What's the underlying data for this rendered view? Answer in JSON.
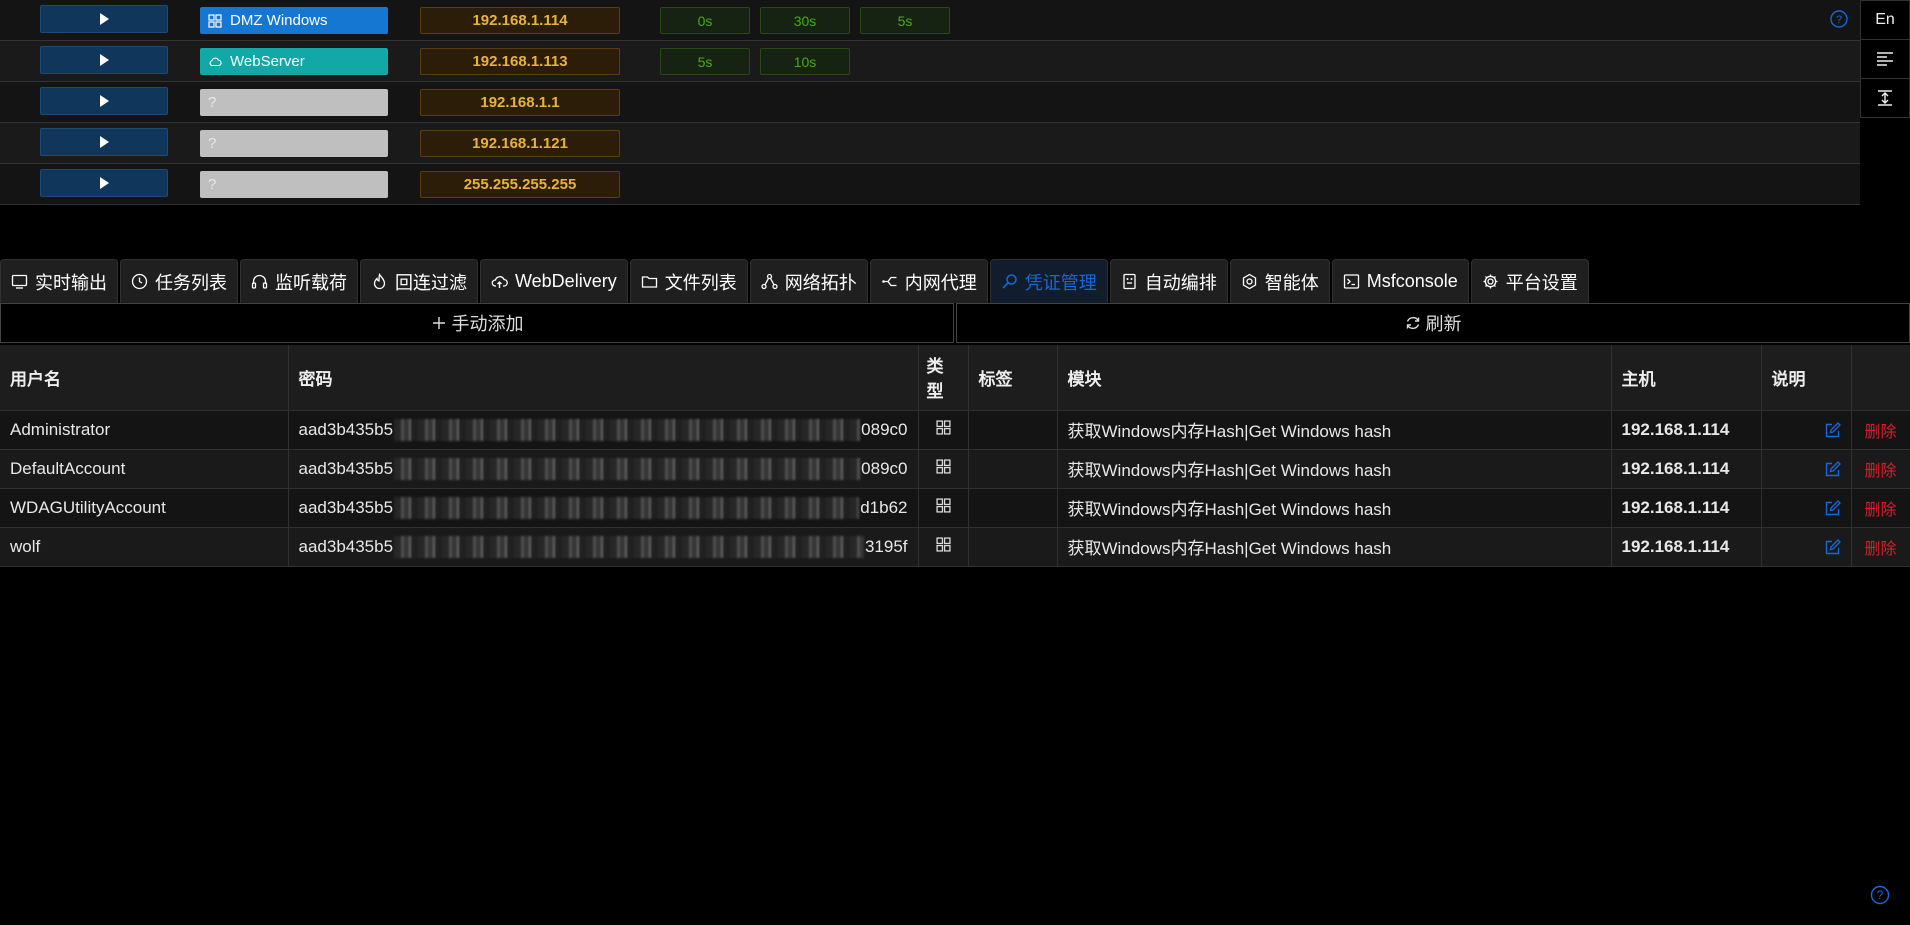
{
  "hosts": [
    {
      "name": "DMZ Windows",
      "icon": "windows-icon",
      "tag_color": "#1677d2",
      "ip": "192.168.1.114",
      "timers": [
        "0s",
        "30s",
        "5s"
      ]
    },
    {
      "name": "WebServer",
      "icon": "cloud-icon",
      "tag_color": "#13a8a8",
      "ip": "192.168.1.113",
      "timers": [
        "5s",
        "10s"
      ]
    },
    {
      "name": "?",
      "icon": "",
      "tag_color": "#bfbfbf",
      "ip": "192.168.1.1",
      "timers": []
    },
    {
      "name": "?",
      "icon": "",
      "tag_color": "#bfbfbf",
      "ip": "192.168.1.121",
      "timers": []
    },
    {
      "name": "?",
      "icon": "",
      "tag_color": "#bfbfbf",
      "ip": "255.255.255.255",
      "timers": []
    }
  ],
  "side_panel": {
    "lang_label": "En"
  },
  "tabs": [
    {
      "label": "实时输出",
      "icon": "monitor-icon"
    },
    {
      "label": "任务列表",
      "icon": "clock-icon"
    },
    {
      "label": "监听载荷",
      "icon": "headphones-icon"
    },
    {
      "label": "回连过滤",
      "icon": "fire-icon"
    },
    {
      "label": "WebDelivery",
      "icon": "cloud-upload-icon"
    },
    {
      "label": "文件列表",
      "icon": "folder-icon"
    },
    {
      "label": "网络拓扑",
      "icon": "topology-icon"
    },
    {
      "label": "内网代理",
      "icon": "proxy-icon"
    },
    {
      "label": "凭证管理",
      "icon": "key-search-icon",
      "active": true
    },
    {
      "label": "自动编排",
      "icon": "robot-icon"
    },
    {
      "label": "智能体",
      "icon": "openai-icon"
    },
    {
      "label": "Msfconsole",
      "icon": "terminal-icon"
    },
    {
      "label": "平台设置",
      "icon": "gear-icon"
    }
  ],
  "actions": {
    "add_label": "手动添加",
    "refresh_label": "刷新"
  },
  "table": {
    "columns": {
      "username": "用户名",
      "password": "密码",
      "type": "类型",
      "tag": "标签",
      "module": "模块",
      "host": "主机",
      "note": "说明"
    },
    "rows": [
      {
        "username": "Administrator",
        "pw_prefix": "aad3b435b5",
        "pw_suffix": "089c0",
        "module": "获取Windows内存Hash|Get Windows hash",
        "host": "192.168.1.114",
        "delete": "删除"
      },
      {
        "username": "DefaultAccount",
        "pw_prefix": "aad3b435b5",
        "pw_suffix": "089c0",
        "module": "获取Windows内存Hash|Get Windows hash",
        "host": "192.168.1.114",
        "delete": "删除"
      },
      {
        "username": "WDAGUtilityAccount",
        "pw_prefix": "aad3b435b5",
        "pw_suffix": "d1b62",
        "module": "获取Windows内存Hash|Get Windows hash",
        "host": "192.168.1.114",
        "delete": "删除"
      },
      {
        "username": "wolf",
        "pw_prefix": "aad3b435b5",
        "pw_suffix": "3195f",
        "module": "获取Windows内存Hash|Get Windows hash",
        "host": "192.168.1.114",
        "delete": "删除"
      }
    ]
  },
  "colors": {
    "accent": "#1668dc",
    "ip": "#e8b339",
    "timer": "#49aa19",
    "danger": "#d32029"
  }
}
